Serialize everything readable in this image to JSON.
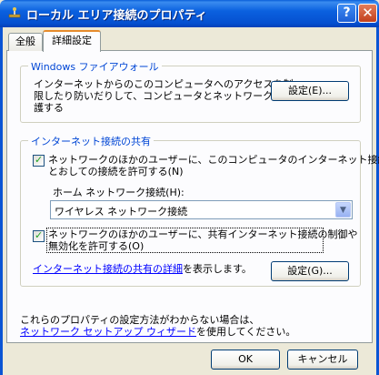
{
  "window": {
    "title": "ローカル エリア接続のプロパティ",
    "help_label": "?",
    "close_label": "✕"
  },
  "tabs": [
    {
      "label": "全般",
      "active": false
    },
    {
      "label": "詳細設定",
      "active": true
    }
  ],
  "firewall": {
    "group_title": "Windows ファイアウォール",
    "description_line1": "インターネットからのこのコンピュータへのアクセスを制",
    "description_line2": "限したり防いだりして、コンピュータとネットワークを保",
    "description_line3": "護する",
    "settings_button": "設定(E)..."
  },
  "sharing": {
    "group_title": "インターネット接続の共有",
    "allow_connect_line1": "ネットワークのほかのユーザーに、このコンピュータのインターネット接続を",
    "allow_connect_line2": "とおしての接続を許可する(N)",
    "allow_connect_checked": true,
    "home_network_label": "ホーム ネットワーク接続(H):",
    "home_network_value": "ワイヤレス ネットワーク接続",
    "allow_control_line1": "ネットワークのほかのユーザーに、共有インターネット接続の制御や",
    "allow_control_line2": "無効化を許可する(O)",
    "allow_control_checked": true,
    "details_link": "インターネット接続の共有の詳細",
    "details_suffix": "を表示します。",
    "settings_button": "設定(G)..."
  },
  "footer": {
    "help_line1": "これらのプロパティの設定方法がわからない場合は、",
    "wizard_link": "ネットワーク セットアップ ウィザード",
    "help_suffix": "を使用してください。"
  },
  "buttons": {
    "ok": "OK",
    "cancel": "キャンセル"
  },
  "colors": {
    "titlebar": "#0b61df",
    "group_title": "#0046d5",
    "link": "#0000ff",
    "tab_highlight": "#e68b2c"
  }
}
